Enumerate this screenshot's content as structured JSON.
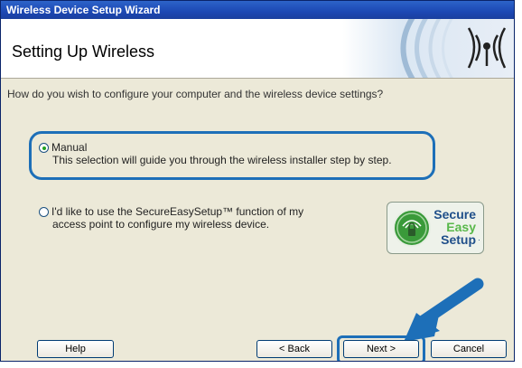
{
  "window": {
    "title": "Wireless Device Setup Wizard"
  },
  "header": {
    "title": "Setting Up Wireless",
    "graphic_icon": "wireless-signal-icon"
  },
  "prompt": "How do you wish to configure your computer and the wireless device settings?",
  "options": [
    {
      "label": "Manual",
      "description": "This selection will guide you through the wireless installer step by step.",
      "selected": true
    },
    {
      "label": "I'd like to use the SecureEasySetup™ function of my",
      "description": "access point to configure my wireless device.",
      "selected": false
    }
  ],
  "logo": {
    "line1": "Secure",
    "line2": "Easy",
    "line3": "Setup",
    "trademark": "·"
  },
  "buttons": {
    "help": "Help",
    "back": "< Back",
    "next": "Next >",
    "cancel": "Cancel"
  },
  "colors": {
    "highlight": "#1d6fb8",
    "titlebar": "#1c48b4",
    "dialog": "#ece9d8",
    "logo_green": "#3a9a3a",
    "logo_blue": "#1f4f8a"
  }
}
